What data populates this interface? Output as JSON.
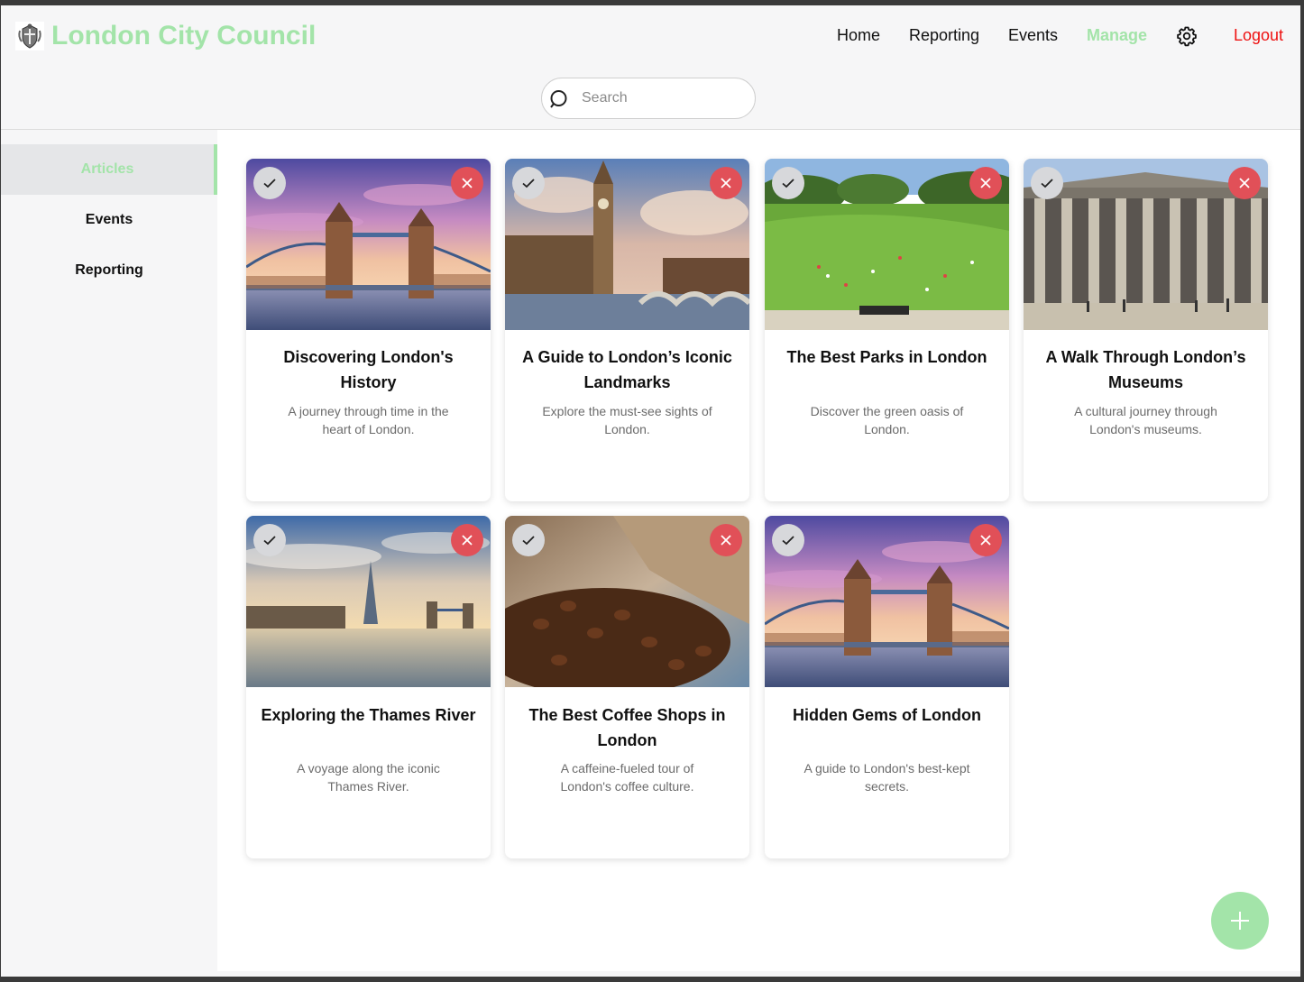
{
  "app": {
    "title": "London City Council",
    "accent_color": "#a3e4a9",
    "danger_color": "#e15058"
  },
  "nav": {
    "home": "Home",
    "reporting": "Reporting",
    "events": "Events",
    "manage": "Manage",
    "settings_icon": "gear-icon",
    "logout": "Logout",
    "active": "Manage"
  },
  "search": {
    "placeholder": "Search",
    "value": ""
  },
  "sidebar": {
    "items": [
      {
        "label": "Articles",
        "active": true
      },
      {
        "label": "Events",
        "active": false
      },
      {
        "label": "Reporting",
        "active": false
      }
    ]
  },
  "articles": [
    {
      "title": "Discovering London's History",
      "description": "A journey through time in the heart of London.",
      "image": "tower-bridge-sunset"
    },
    {
      "title": "A Guide to London’s Iconic Landmarks",
      "description": "Explore the must-see sights of London.",
      "image": "big-ben"
    },
    {
      "title": "The Best Parks in London",
      "description": "Discover the green oasis of London.",
      "image": "park-lawn"
    },
    {
      "title": "A Walk Through London’s Museums",
      "description": "A cultural journey through London's museums.",
      "image": "british-museum"
    },
    {
      "title": "Exploring the Thames River",
      "description": "A voyage along the iconic Thames River.",
      "image": "thames-skyline"
    },
    {
      "title": "The Best Coffee Shops in London",
      "description": "A caffeine-fueled tour of London's coffee culture.",
      "image": "coffee-beans"
    },
    {
      "title": "Hidden Gems of London",
      "description": "A guide to London's best-kept secrets.",
      "image": "tower-bridge-sunset"
    }
  ],
  "card_actions": {
    "approve_icon": "check-icon",
    "reject_icon": "close-icon"
  },
  "fab": {
    "icon": "plus-icon"
  }
}
